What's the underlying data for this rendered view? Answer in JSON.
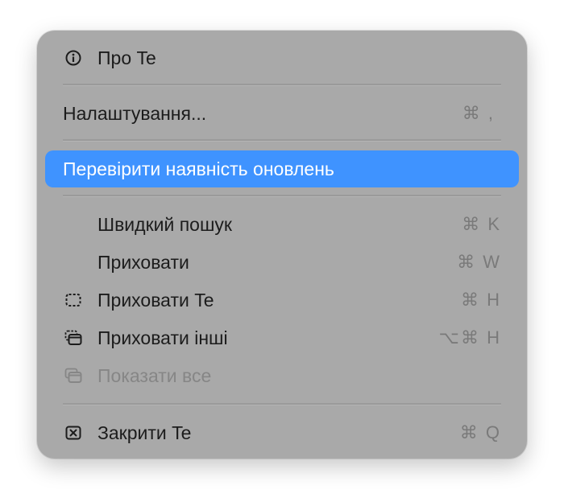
{
  "menu": {
    "items": [
      {
        "label": "Про Te",
        "icon": "info-circle-icon"
      },
      {
        "label": "Налаштування...",
        "shortcut": "⌘ ,"
      },
      {
        "label": "Перевірити наявність оновлень",
        "highlighted": true
      },
      {
        "label": "Швидкий пошук",
        "shortcut": "⌘ K"
      },
      {
        "label": "Приховати",
        "shortcut": "⌘ W"
      },
      {
        "label": "Приховати Te",
        "shortcut": "⌘ H",
        "icon": "dashed-window-icon"
      },
      {
        "label": "Приховати інші",
        "shortcut": "⌥⌘ H",
        "icon": "stacked-windows-icon"
      },
      {
        "label": "Показати все",
        "disabled": true,
        "icon": "show-all-windows-icon"
      },
      {
        "label": "Закрити Te",
        "shortcut": "⌘ Q",
        "icon": "close-box-icon"
      }
    ]
  },
  "colors": {
    "menu_background": "#a9a9a9",
    "highlight": "#3f93ff",
    "text": "#1c1c1c",
    "shortcut_text": "#7a7a7a",
    "disabled_text": "#868686"
  }
}
